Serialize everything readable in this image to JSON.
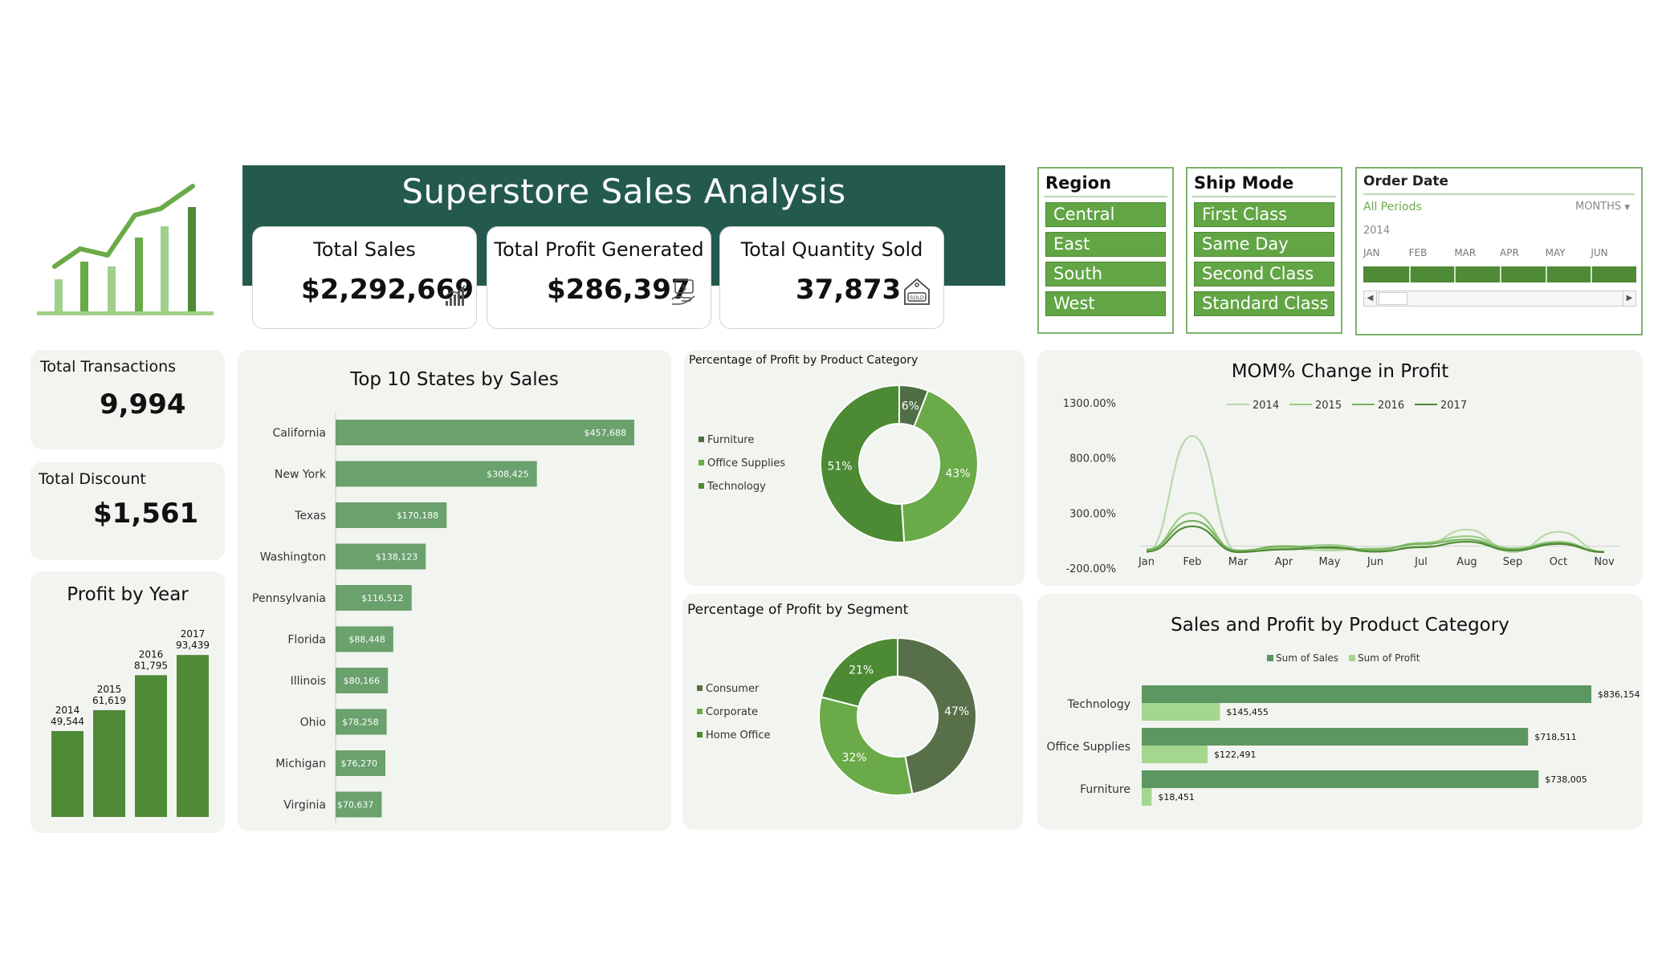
{
  "header": {
    "title": "Superstore Sales Analysis"
  },
  "kpis": {
    "total_sales": {
      "label": "Total Sales",
      "value": "$2,292,669"
    },
    "total_profit": {
      "label": "Total Profit Generated",
      "value": "$286,397"
    },
    "total_quantity": {
      "label": "Total Quantity Sold",
      "value": "37,873"
    },
    "total_transactions": {
      "label": "Total Transactions",
      "value": "9,994"
    },
    "total_discount": {
      "label": "Total Discount",
      "value": "$1,561"
    }
  },
  "icons": {
    "logo": "growth-bar-chart-icon",
    "sales": "signal-bars-icon",
    "profit": "money-hand-icon",
    "quantity": "sold-tag-bag-icon"
  },
  "slicers": {
    "region": {
      "title": "Region",
      "items": [
        "Central",
        "East",
        "South",
        "West"
      ]
    },
    "ship_mode": {
      "title": "Ship Mode",
      "items": [
        "First Class",
        "Same Day",
        "Second Class",
        "Standard Class"
      ]
    },
    "order_date": {
      "title": "Order Date",
      "period_label": "All Periods",
      "level_label": "MONTHS",
      "year": "2014",
      "months": [
        "JAN",
        "FEB",
        "MAR",
        "APR",
        "MAY",
        "JUN"
      ]
    }
  },
  "colors": {
    "header": "#245a4e",
    "accent_green": "#62a545",
    "dark_green": "#4f8a37",
    "mid_green": "#6ba56e",
    "panel": "#f2f4f0"
  },
  "chart_data": [
    {
      "id": "profit_by_year",
      "type": "bar",
      "title": "Profit by Year",
      "categories": [
        "2014",
        "2015",
        "2016",
        "2017"
      ],
      "values": [
        49544,
        61619,
        81795,
        93439
      ],
      "labels": [
        "49,544",
        "61,619",
        "81,795",
        "93,439"
      ],
      "ylim": [
        0,
        100000
      ]
    },
    {
      "id": "top_states",
      "type": "bar",
      "orientation": "horizontal",
      "title": "Top 10 States by Sales",
      "categories": [
        "California",
        "New York",
        "Texas",
        "Washington",
        "Pennsylvania",
        "Florida",
        "Illinois",
        "Ohio",
        "Michigan",
        "Virginia"
      ],
      "values": [
        457688,
        308425,
        170188,
        138123,
        116512,
        88448,
        80166,
        78258,
        76270,
        70637
      ],
      "labels": [
        "$457,688",
        "$308,425",
        "$170,188",
        "$138,123",
        "$116,512",
        "$88,448",
        "$80,166",
        "$78,258",
        "$76,270",
        "$70,637"
      ]
    },
    {
      "id": "profit_by_category",
      "type": "pie",
      "title": "Percentage of Profit by Product Category",
      "categories": [
        "Furniture",
        "Office Supplies",
        "Technology"
      ],
      "values": [
        6,
        43,
        51
      ],
      "labels": [
        "6%",
        "43%",
        "51%"
      ],
      "colors": [
        "#4f6e45",
        "#6aaa48",
        "#4c8a34"
      ]
    },
    {
      "id": "profit_by_segment",
      "type": "pie",
      "title": "Percentage of Profit by Segment",
      "categories": [
        "Consumer",
        "Corporate",
        "Home Office"
      ],
      "values": [
        47,
        32,
        21
      ],
      "labels": [
        "47%",
        "32%",
        "21%"
      ],
      "colors": [
        "#587049",
        "#6aaa48",
        "#4c8a34"
      ]
    },
    {
      "id": "mom_profit",
      "type": "line",
      "title": "MOM% Change in Profit",
      "x": [
        "Jan",
        "Feb",
        "Mar",
        "Apr",
        "May",
        "Jun",
        "Jul",
        "Aug",
        "Sep",
        "Oct",
        "Nov"
      ],
      "yticks": [
        "1300.00%",
        "800.00%",
        "300.00%",
        "-200.00%"
      ],
      "ylim": [
        -200,
        1300
      ],
      "series": [
        {
          "name": "2014",
          "color": "#b8d8aa",
          "values": [
            -60,
            1000,
            -80,
            -20,
            -40,
            -20,
            0,
            150,
            -60,
            130,
            -100
          ]
        },
        {
          "name": "2015",
          "color": "#9ccc86",
          "values": [
            -40,
            300,
            -60,
            -10,
            10,
            -40,
            30,
            90,
            -20,
            40,
            -60
          ]
        },
        {
          "name": "2016",
          "color": "#76b25e",
          "values": [
            -30,
            230,
            -40,
            0,
            -20,
            -30,
            20,
            60,
            -30,
            30,
            -50
          ]
        },
        {
          "name": "2017",
          "color": "#4d8a35",
          "values": [
            -50,
            180,
            -80,
            -30,
            -10,
            -50,
            -10,
            40,
            -40,
            20,
            -70
          ]
        }
      ]
    },
    {
      "id": "sales_profit_category",
      "type": "bar",
      "orientation": "horizontal",
      "title": "Sales and Profit by Product Category",
      "categories": [
        "Technology",
        "Office Supplies",
        "Furniture"
      ],
      "series": [
        {
          "name": "Sum of Sales",
          "color": "#5c9660",
          "values": [
            836154,
            718511,
            738005
          ],
          "labels": [
            "$836,154",
            "$718,511",
            "$738,005"
          ]
        },
        {
          "name": "Sum of Profit",
          "color": "#a5d68e",
          "values": [
            145455,
            122491,
            18451
          ],
          "labels": [
            "$145,455",
            "$122,491",
            "$18,451"
          ]
        }
      ]
    }
  ]
}
